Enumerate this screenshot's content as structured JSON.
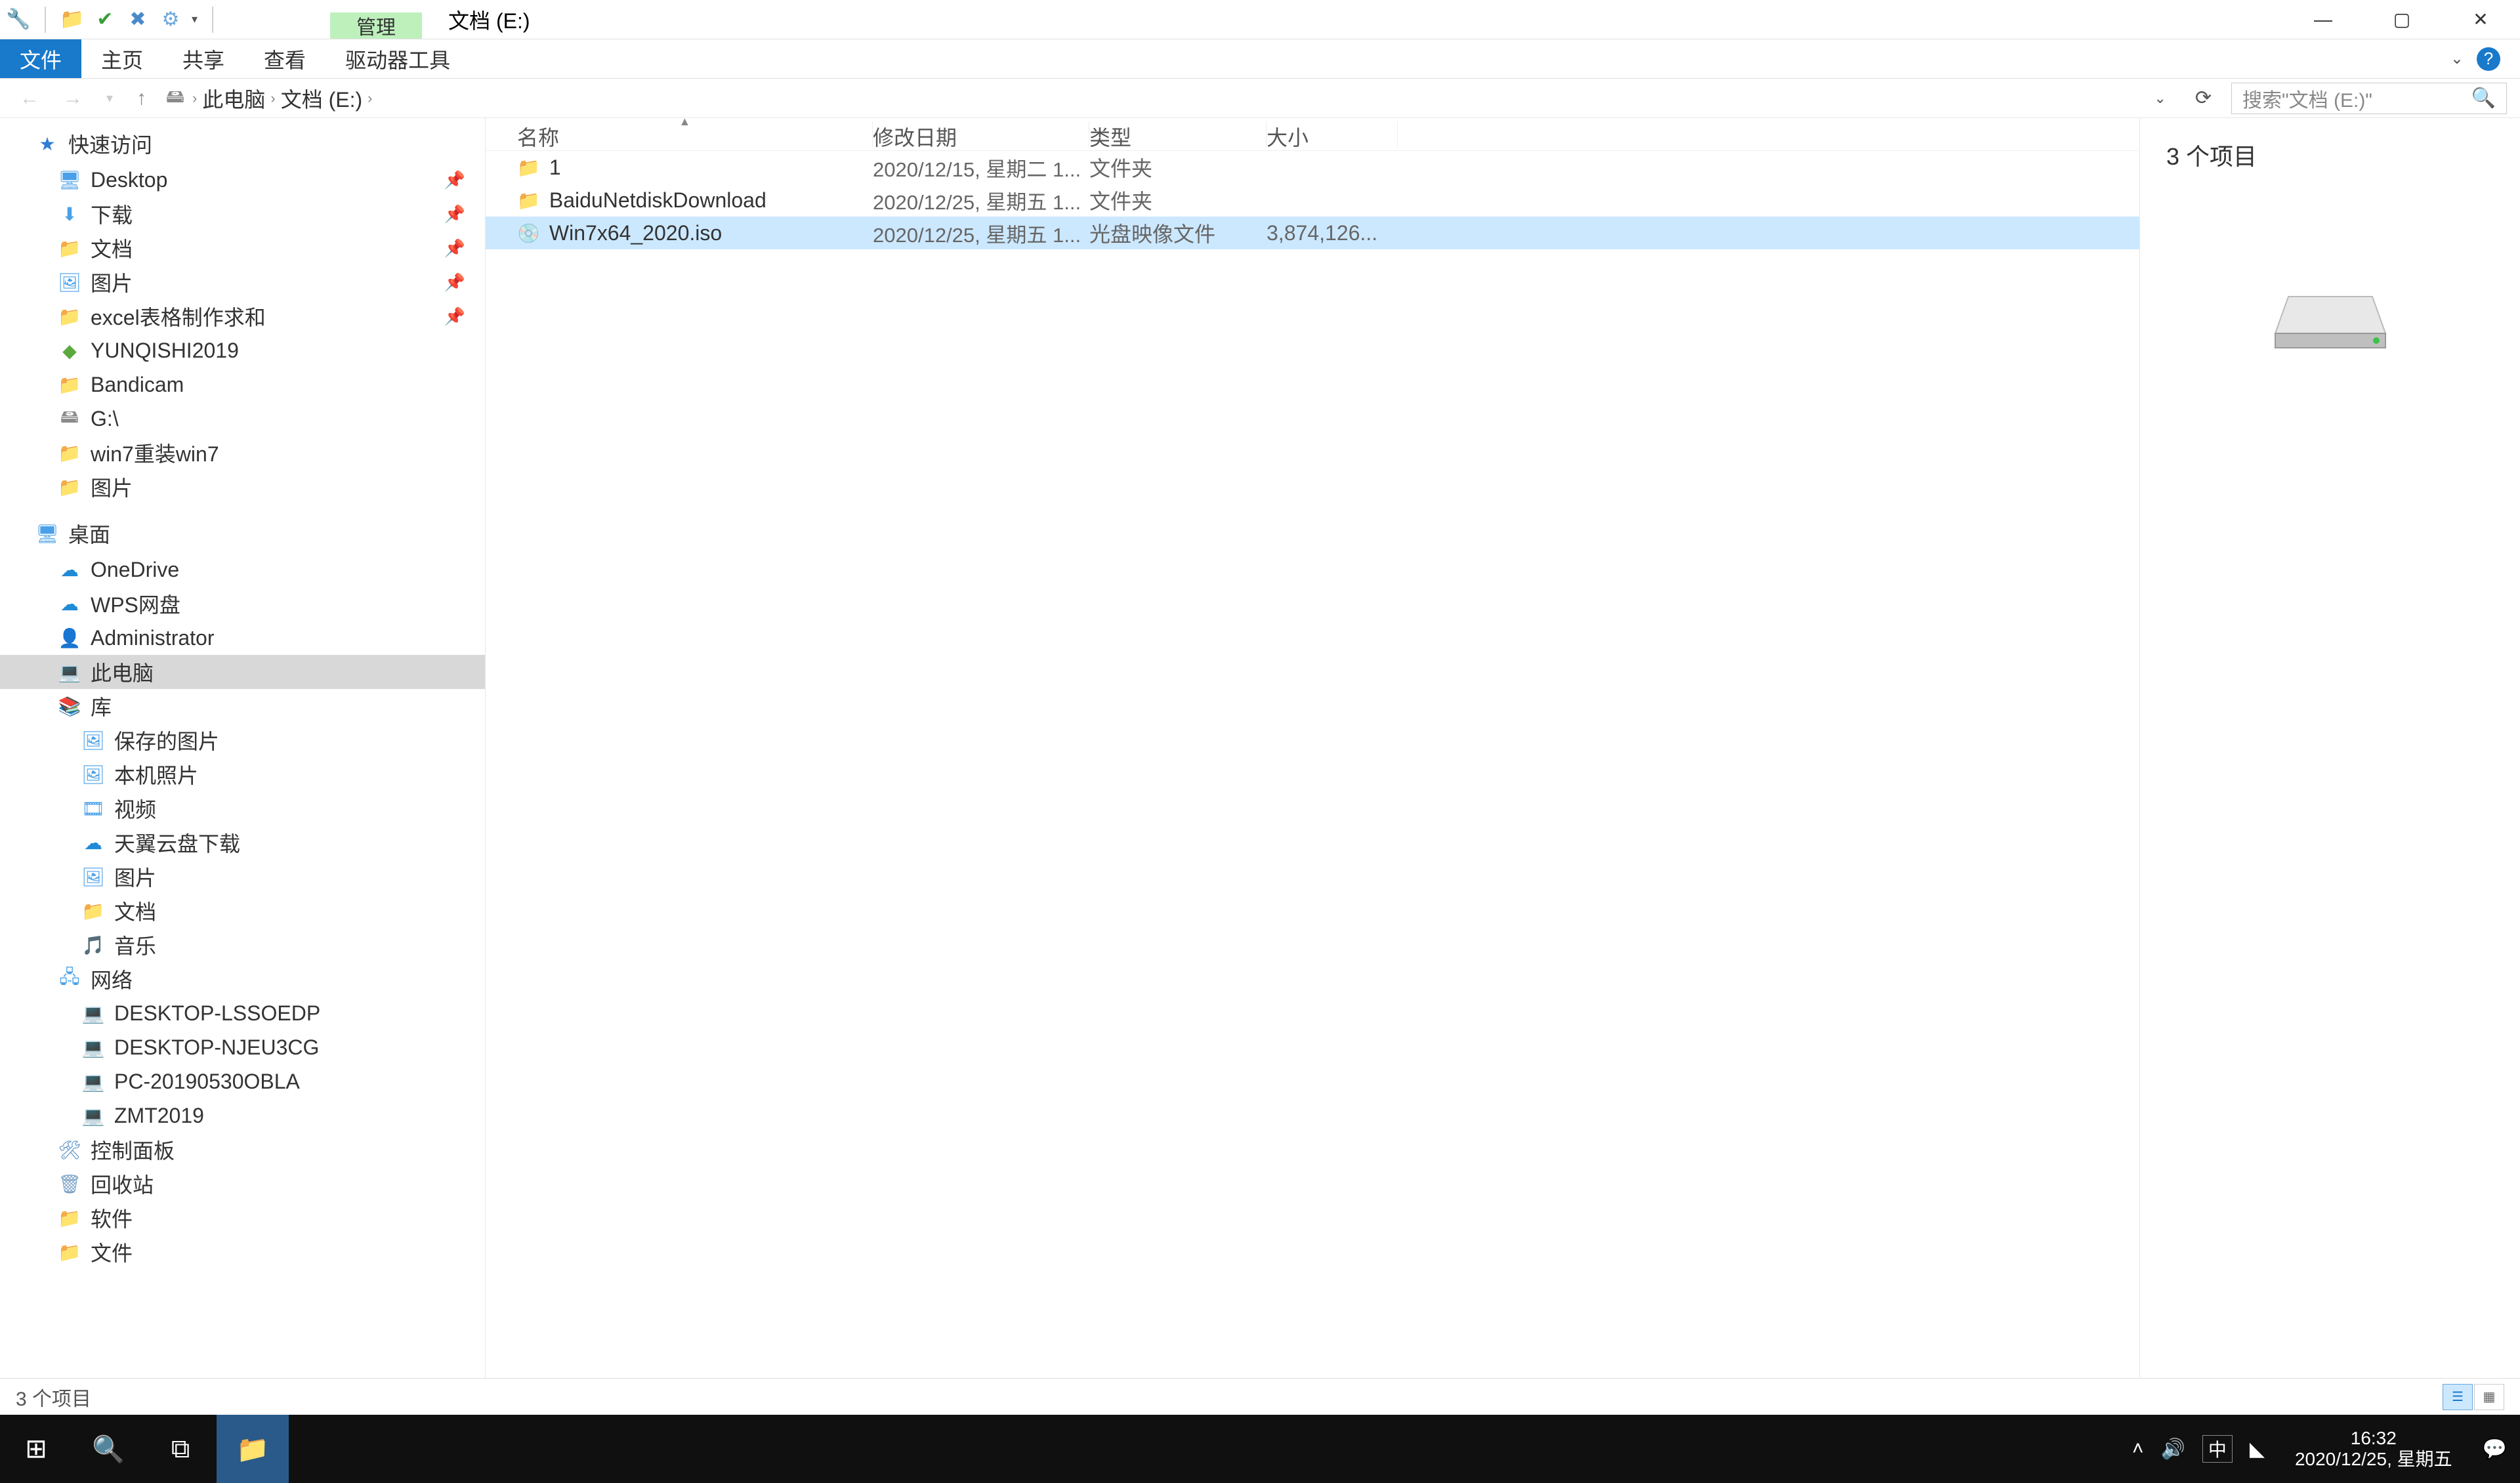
{
  "titlebar": {
    "context_tab": "管理",
    "title": "文档 (E:)"
  },
  "ribbon": {
    "file": "文件",
    "home": "主页",
    "share": "共享",
    "view": "查看",
    "drive_tools": "驱动器工具"
  },
  "breadcrumb": {
    "root": "此电脑",
    "current": "文档 (E:)"
  },
  "search": {
    "placeholder": "搜索\"文档 (E:)\""
  },
  "nav": {
    "quick_access": "快速访问",
    "desktop": "Desktop",
    "downloads": "下载",
    "documents": "文档",
    "pictures": "图片",
    "excel": "excel表格制作求和",
    "yunqishi": "YUNQISHI2019",
    "bandicam": "Bandicam",
    "g_drive": "G:\\",
    "win7reinstall": "win7重装win7",
    "pictures2": "图片",
    "desktop_root": "桌面",
    "onedrive": "OneDrive",
    "wps": "WPS网盘",
    "admin": "Administrator",
    "this_pc": "此电脑",
    "libraries": "库",
    "saved_pics": "保存的图片",
    "camera_roll": "本机照片",
    "videos": "视频",
    "tianyi": "天翼云盘下载",
    "lib_pics": "图片",
    "lib_docs": "文档",
    "lib_music": "音乐",
    "network": "网络",
    "net1": "DESKTOP-LSSOEDP",
    "net2": "DESKTOP-NJEU3CG",
    "net3": "PC-20190530OBLA",
    "net4": "ZMT2019",
    "control_panel": "控制面板",
    "recycle": "回收站",
    "software": "软件",
    "files": "文件"
  },
  "columns": {
    "name": "名称",
    "date": "修改日期",
    "type": "类型",
    "size": "大小"
  },
  "files": [
    {
      "name": "1",
      "date": "2020/12/15, 星期二 1...",
      "type": "文件夹",
      "size": "",
      "icon": "folder"
    },
    {
      "name": "BaiduNetdiskDownload",
      "date": "2020/12/25, 星期五 1...",
      "type": "文件夹",
      "size": "",
      "icon": "folder"
    },
    {
      "name": "Win7x64_2020.iso",
      "date": "2020/12/25, 星期五 1...",
      "type": "光盘映像文件",
      "size": "3,874,126...",
      "icon": "iso",
      "selected": true
    }
  ],
  "preview": {
    "title": "3 个项目"
  },
  "status": {
    "text": "3 个项目"
  },
  "clock": {
    "time": "16:32",
    "date": "2020/12/25, 星期五"
  },
  "ime": "中"
}
